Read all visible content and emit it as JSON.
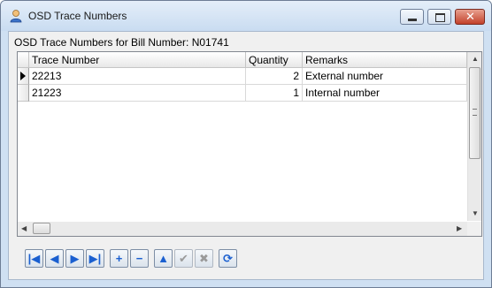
{
  "window": {
    "title": "OSD Trace Numbers"
  },
  "grid": {
    "caption": "OSD Trace Numbers for Bill Number: N01741",
    "columns": [
      "Trace Number",
      "Quantity",
      "Remarks"
    ],
    "rows": [
      {
        "trace": "22213",
        "qty": "2",
        "remarks": "External number",
        "selected": true
      },
      {
        "trace": "21223",
        "qty": "1",
        "remarks": "Internal number",
        "selected": false
      }
    ]
  },
  "navigator": {
    "buttons": [
      {
        "icon": "first-record-icon",
        "glyph": "|◀",
        "enabled": true
      },
      {
        "icon": "prior-record-icon",
        "glyph": "◀",
        "enabled": true
      },
      {
        "icon": "next-record-icon",
        "glyph": "▶",
        "enabled": true
      },
      {
        "icon": "last-record-icon",
        "glyph": "▶|",
        "enabled": true
      },
      {
        "icon": "insert-icon",
        "glyph": "+",
        "enabled": true
      },
      {
        "icon": "delete-icon",
        "glyph": "−",
        "enabled": true
      },
      {
        "icon": "edit-icon",
        "glyph": "▲",
        "enabled": true
      },
      {
        "icon": "post-icon",
        "glyph": "✔",
        "enabled": false
      },
      {
        "icon": "cancel-icon",
        "glyph": "✖",
        "enabled": false
      },
      {
        "icon": "refresh-icon",
        "glyph": "⟳",
        "enabled": true
      }
    ]
  },
  "colors": {
    "accent": "#1a5fd0",
    "window_frame": "#cfe0f2"
  }
}
